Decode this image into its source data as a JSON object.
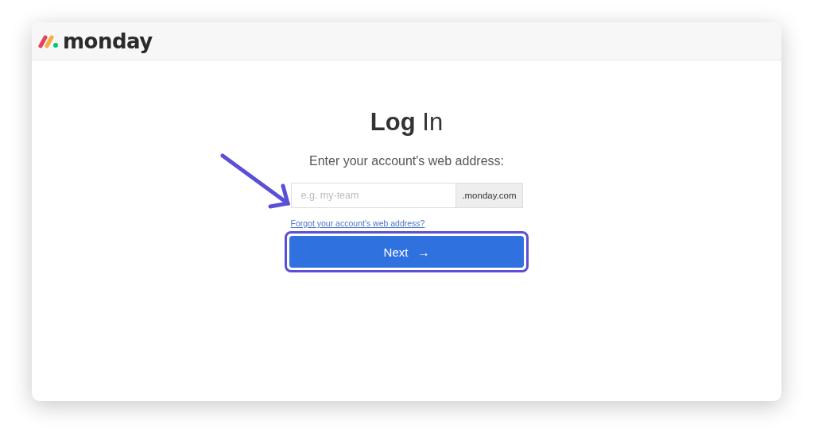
{
  "header": {
    "logo_text": "monday"
  },
  "login": {
    "title": "**Log** In",
    "subtitle": "Enter your account's web address:",
    "address_field": {
      "placeholder": "e.g. my-team",
      "suffix": ".monday.com"
    },
    "forgot_link": "Forgot your account's web address?",
    "next_button": {
      "label": "Next",
      "icon": "→",
      "highlighted": true
    }
  },
  "annotation": {
    "kind": "arrow"
  }
}
